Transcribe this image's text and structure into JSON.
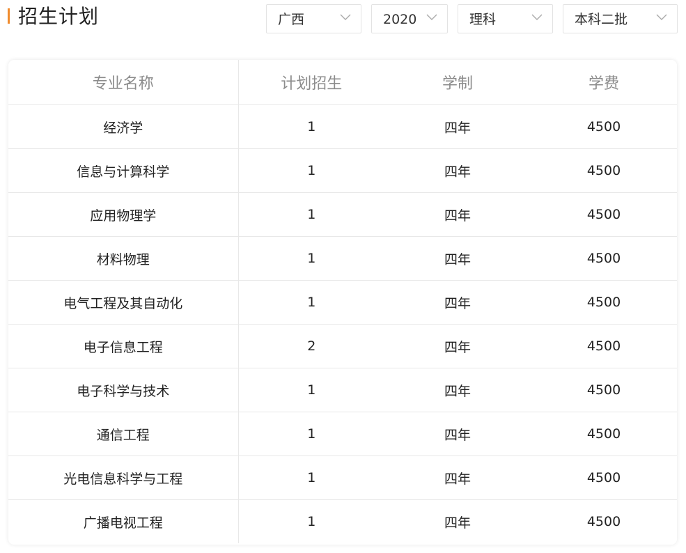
{
  "header": {
    "title": "招生计划"
  },
  "filters": [
    {
      "value": "广西"
    },
    {
      "value": "2020"
    },
    {
      "value": "理科"
    },
    {
      "value": "本科二批"
    }
  ],
  "table": {
    "columns": [
      "专业名称",
      "计划招生",
      "学制",
      "学费"
    ],
    "rows": [
      {
        "major": "经济学",
        "plan": "1",
        "duration": "四年",
        "fee": "4500"
      },
      {
        "major": "信息与计算科学",
        "plan": "1",
        "duration": "四年",
        "fee": "4500"
      },
      {
        "major": "应用物理学",
        "plan": "1",
        "duration": "四年",
        "fee": "4500"
      },
      {
        "major": "材料物理",
        "plan": "1",
        "duration": "四年",
        "fee": "4500"
      },
      {
        "major": "电气工程及其自动化",
        "plan": "1",
        "duration": "四年",
        "fee": "4500"
      },
      {
        "major": "电子信息工程",
        "plan": "2",
        "duration": "四年",
        "fee": "4500"
      },
      {
        "major": "电子科学与技术",
        "plan": "1",
        "duration": "四年",
        "fee": "4500"
      },
      {
        "major": "通信工程",
        "plan": "1",
        "duration": "四年",
        "fee": "4500"
      },
      {
        "major": "光电信息科学与工程",
        "plan": "1",
        "duration": "四年",
        "fee": "4500"
      },
      {
        "major": "广播电视工程",
        "plan": "1",
        "duration": "四年",
        "fee": "4500"
      }
    ]
  },
  "colors": {
    "accent": "#f08c2e",
    "header_text": "#8c8c8c",
    "border": "#e8e8e8"
  },
  "icons": {
    "dropdown": "chevron-down-icon"
  }
}
